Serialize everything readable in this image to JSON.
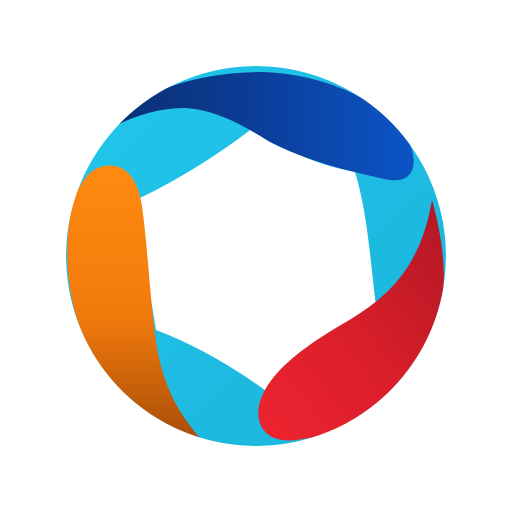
{
  "logo": {
    "icon": "ring-logo-icon",
    "colors": {
      "background": "#ffffff",
      "ring_light_blue": "#22C7EC",
      "ring_light_blue_shade": "#1AB3DA",
      "band_dark_blue_start": "#0A2E6E",
      "band_dark_blue_mid": "#0B3C95",
      "band_dark_blue_end": "#0C54C6",
      "band_red_dark": "#B01825",
      "band_red_mid": "#D81E2A",
      "band_red_light": "#EE2430",
      "band_orange_light": "#FF8A10",
      "band_orange_mid": "#F27A0C",
      "band_orange_dark": "#A94E08"
    }
  }
}
